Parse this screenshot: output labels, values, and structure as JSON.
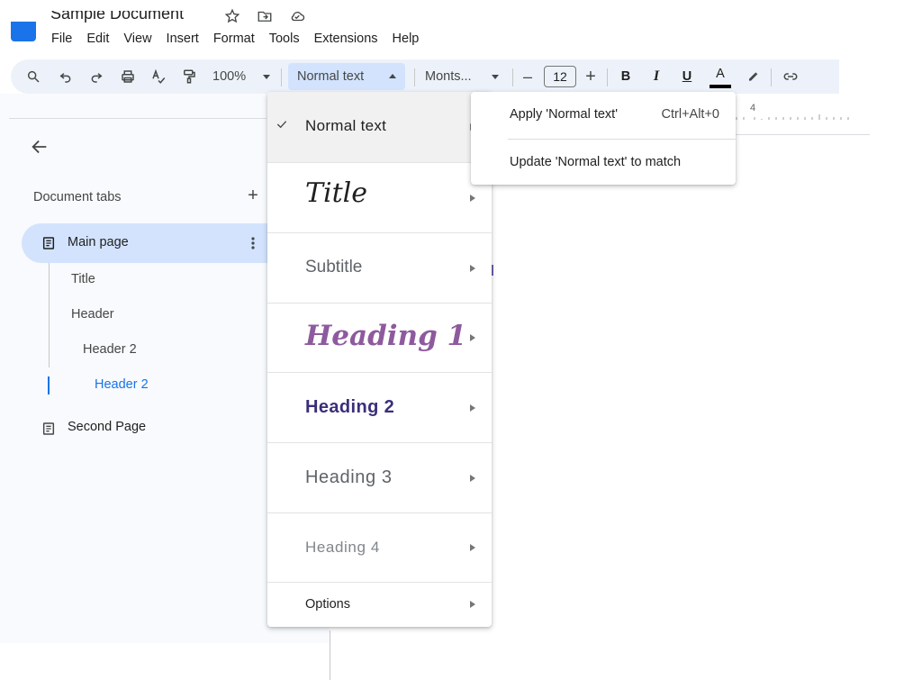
{
  "app": {
    "doc_title": "Sample Document"
  },
  "menubar": [
    "File",
    "Edit",
    "View",
    "Insert",
    "Format",
    "Tools",
    "Extensions",
    "Help"
  ],
  "toolbar": {
    "zoom": "100%",
    "paragraph_style": "Normal text",
    "font": "Monts...",
    "font_size": "12",
    "minus": "–",
    "plus": "+",
    "bold": "B",
    "italic": "I",
    "underline": "U",
    "text_color": "A"
  },
  "left_panel": {
    "title": "Document tabs",
    "add": "+",
    "tabs": [
      {
        "label": "Main page",
        "outline": [
          {
            "label": "Title",
            "level": 1,
            "active": false
          },
          {
            "label": "Header",
            "level": 1,
            "active": false
          },
          {
            "label": "Header 2",
            "level": 2,
            "active": false
          },
          {
            "label": "Header 2",
            "level": 3,
            "active": true
          }
        ]
      },
      {
        "label": "Second Page"
      }
    ]
  },
  "ruler": {
    "mark": "4"
  },
  "style_menu": {
    "items": [
      {
        "label": "Normal text",
        "selected": true
      },
      {
        "label": "Title",
        "selected": false
      },
      {
        "label": "Subtitle",
        "selected": false
      },
      {
        "label": "Heading 1",
        "selected": false
      },
      {
        "label": "Heading 2",
        "selected": false
      },
      {
        "label": "Heading 3",
        "selected": false
      },
      {
        "label": "Heading 4",
        "selected": false
      },
      {
        "label": "Options",
        "selected": false
      }
    ]
  },
  "sub_menu": {
    "apply_label": "Apply 'Normal text'",
    "apply_shortcut": "Ctrl+Alt+0",
    "update_label": "Update 'Normal text' to match"
  },
  "colors": {
    "toolbar_bg": "#edf2fa",
    "selection_bg": "#d3e3fd",
    "accent_blue": "#1a73e8",
    "heading1_color": "#8e5a9e",
    "heading2_color": "#3b2f7a"
  }
}
